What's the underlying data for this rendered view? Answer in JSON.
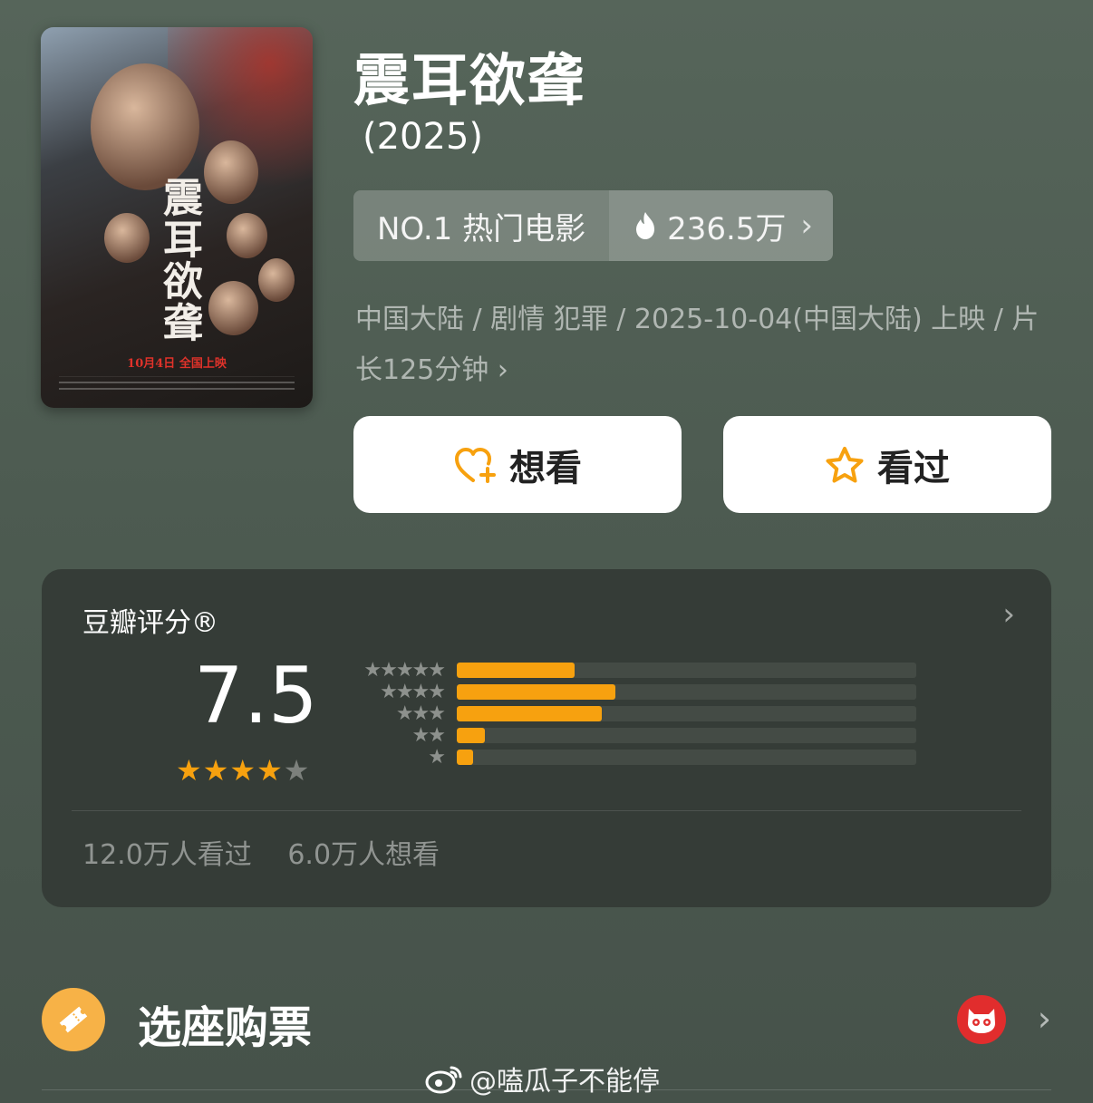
{
  "movie": {
    "title": "震耳欲聋",
    "year": "(2025)",
    "poster": {
      "title_text": "震耳欲聋",
      "release_text": "10月4日 全国上映"
    }
  },
  "rank": {
    "label": "NO.1 热门电影",
    "heat": "236.5万",
    "icon": "flame-icon"
  },
  "meta": {
    "line": "中国大陆 / 剧情 犯罪 / 2025-10-04(中国大陆) 上映 / 片长125分钟",
    "chevron": "›"
  },
  "actions": {
    "want_label": "想看",
    "seen_label": "看过",
    "accent_color": "#f7a10f"
  },
  "rating": {
    "label": "豆瓣评分®",
    "score": "7.5",
    "stars_filled": 4,
    "stars_total": 5,
    "distribution": [
      {
        "stars": "★★★★★",
        "value": 0.257
      },
      {
        "stars": "★★★★",
        "value": 0.345
      },
      {
        "stars": "★★★",
        "value": 0.316
      },
      {
        "stars": "★★",
        "value": 0.061
      },
      {
        "stars": "★",
        "value": 0.035
      }
    ],
    "seen_count": "12.0万人看过",
    "want_count": "6.0万人想看",
    "arrow": "›"
  },
  "ticket": {
    "label": "选座购票",
    "chevron": "›"
  },
  "watermark": {
    "text": "@嗑瓜子不能停"
  }
}
